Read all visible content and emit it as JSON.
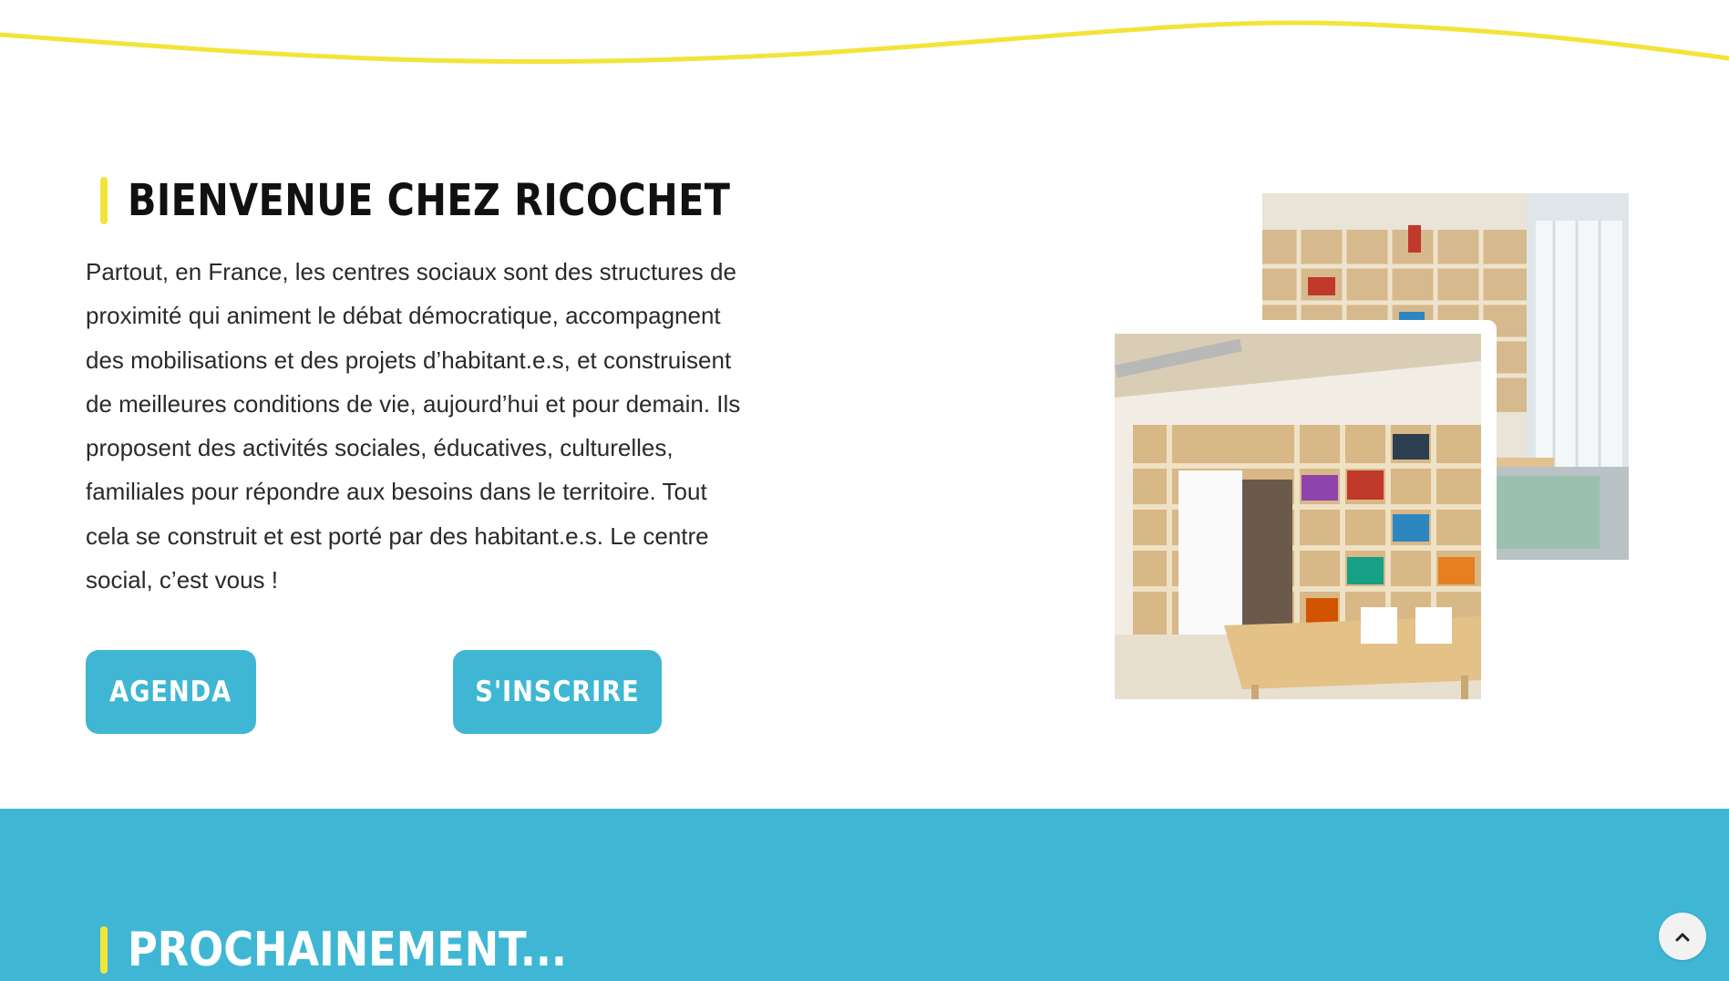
{
  "colors": {
    "accent_yellow": "#f3e43a",
    "brand_blue": "#3fb7d4",
    "text_dark": "#111111",
    "white": "#ffffff"
  },
  "welcome": {
    "title": "BIENVENUE CHEZ RICOCHET",
    "intro_lines": [
      "Partout, en France, les centres sociaux sont des structures de",
      "proximité qui animent le débat démocratique, accompagnent",
      "des mobilisations et des projets d’habitant.e.s, et construisent",
      "de meilleures conditions de vie, aujourd’hui et pour demain. Ils",
      "proposent des activités sociales, éducatives, culturelles,",
      "familiales pour répondre aux besoins dans le territoire. Tout",
      "cela se construit et est porté par des habitant.e.s. Le centre",
      "social, c’est vous !"
    ],
    "buttons": {
      "agenda": "AGENDA",
      "inscrire": "S'INSCRIRE"
    }
  },
  "upcoming": {
    "title": "PROCHAINEMENT..."
  },
  "icons": {
    "scroll_top": "chevron-up-icon"
  }
}
